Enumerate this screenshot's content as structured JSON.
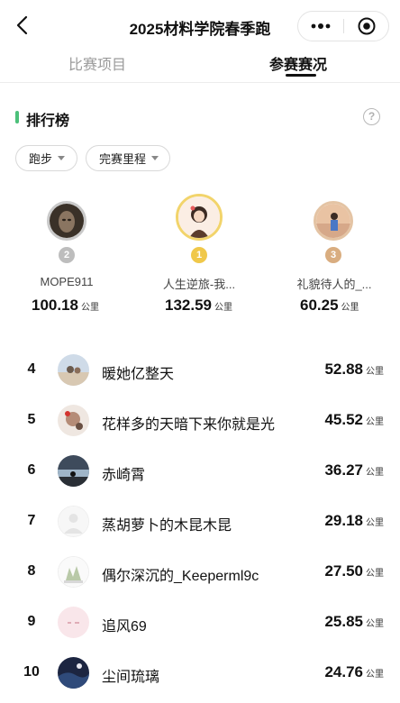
{
  "header": {
    "title": "2025材料学院春季跑"
  },
  "tabs": [
    {
      "label": "比赛项目",
      "active": false
    },
    {
      "label": "参赛赛况",
      "active": true
    }
  ],
  "section": {
    "title": "排行榜"
  },
  "filters": [
    {
      "label": "跑步"
    },
    {
      "label": "完赛里程"
    }
  ],
  "unit": "公里",
  "podium": [
    {
      "rank": "2",
      "name": "MOPE911",
      "distance": "100.18"
    },
    {
      "rank": "1",
      "name": "人生逆旅-我...",
      "distance": "132.59"
    },
    {
      "rank": "3",
      "name": "礼貌待人的_...",
      "distance": "60.25"
    }
  ],
  "rows": [
    {
      "rank": "4",
      "name": "暖她亿整天",
      "distance": "52.88"
    },
    {
      "rank": "5",
      "name": "花样多的天暗下来你就是光",
      "distance": "45.52"
    },
    {
      "rank": "6",
      "name": "赤崎霄",
      "distance": "36.27"
    },
    {
      "rank": "7",
      "name": "蒸胡萝卜的木昆木昆",
      "distance": "29.18"
    },
    {
      "rank": "8",
      "name": "偶尔深沉的_Keeperml9c",
      "distance": "27.50"
    },
    {
      "rank": "9",
      "name": "追风69",
      "distance": "25.85"
    },
    {
      "rank": "10",
      "name": "尘间琉璃",
      "distance": "24.76"
    }
  ],
  "colors": {
    "accent": "#4cc07a",
    "gold": "#f0c84a",
    "silver": "#bdbdbd",
    "bronze": "#d9ad80"
  }
}
